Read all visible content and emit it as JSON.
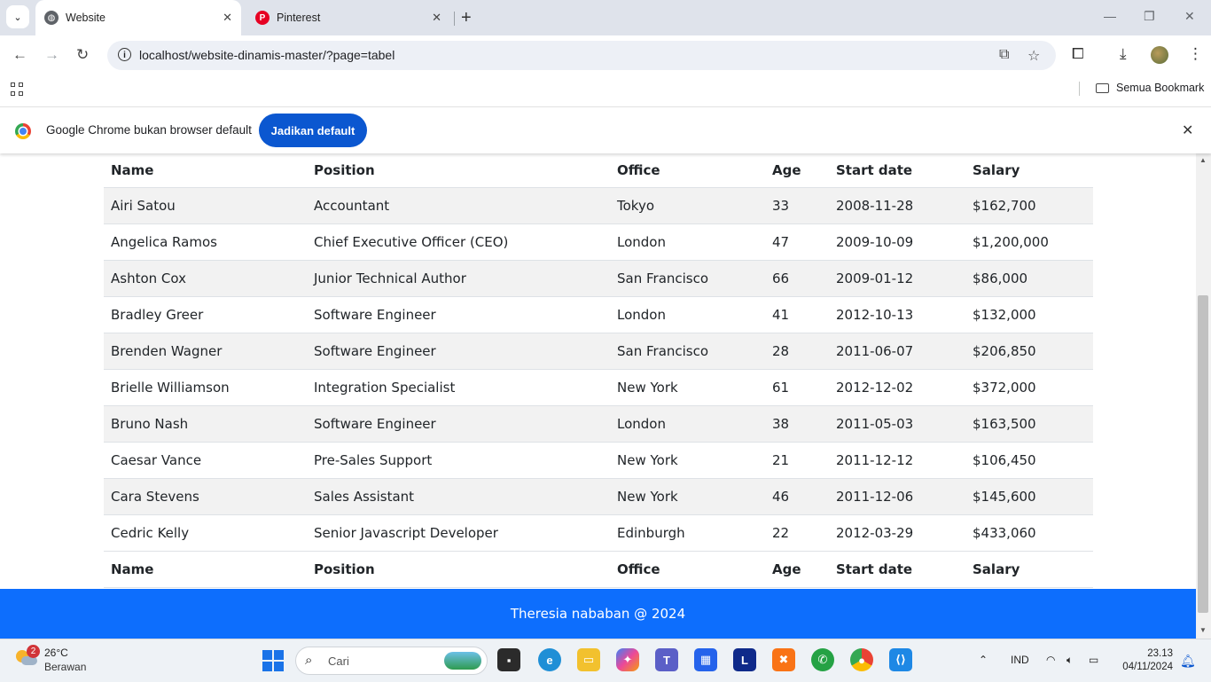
{
  "tabs": [
    {
      "title": "Website",
      "active": true
    },
    {
      "title": "Pinterest",
      "active": false
    }
  ],
  "address_bar": {
    "url": "localhost/website-dinamis-master/?page=tabel"
  },
  "bookmarks": {
    "all_bookmarks_label": "Semua Bookmark"
  },
  "infobar": {
    "message": "Google Chrome bukan browser default",
    "button_label": "Jadikan default"
  },
  "table": {
    "headers": [
      "Name",
      "Position",
      "Office",
      "Age",
      "Start date",
      "Salary"
    ],
    "rows": [
      [
        "Airi Satou",
        "Accountant",
        "Tokyo",
        "33",
        "2008-11-28",
        "$162,700"
      ],
      [
        "Angelica Ramos",
        "Chief Executive Officer (CEO)",
        "London",
        "47",
        "2009-10-09",
        "$1,200,000"
      ],
      [
        "Ashton Cox",
        "Junior Technical Author",
        "San Francisco",
        "66",
        "2009-01-12",
        "$86,000"
      ],
      [
        "Bradley Greer",
        "Software Engineer",
        "London",
        "41",
        "2012-10-13",
        "$132,000"
      ],
      [
        "Brenden Wagner",
        "Software Engineer",
        "San Francisco",
        "28",
        "2011-06-07",
        "$206,850"
      ],
      [
        "Brielle Williamson",
        "Integration Specialist",
        "New York",
        "61",
        "2012-12-02",
        "$372,000"
      ],
      [
        "Bruno Nash",
        "Software Engineer",
        "London",
        "38",
        "2011-05-03",
        "$163,500"
      ],
      [
        "Caesar Vance",
        "Pre-Sales Support",
        "New York",
        "21",
        "2011-12-12",
        "$106,450"
      ],
      [
        "Cara Stevens",
        "Sales Assistant",
        "New York",
        "46",
        "2011-12-06",
        "$145,600"
      ],
      [
        "Cedric Kelly",
        "Senior Javascript Developer",
        "Edinburgh",
        "22",
        "2012-03-29",
        "$433,060"
      ]
    ]
  },
  "footer": {
    "text": "Theresia nababan @ 2024"
  },
  "taskbar": {
    "weather_temp": "26°C",
    "weather_desc": "Berawan",
    "weather_badge": "2",
    "search_placeholder": "Cari",
    "language": "IND",
    "time": "23.13",
    "date": "04/11/2024"
  },
  "colors": {
    "accent_blue": "#0d6efd",
    "chrome_button": "#0b57d0",
    "tab_strip": "#dfe3eb"
  }
}
